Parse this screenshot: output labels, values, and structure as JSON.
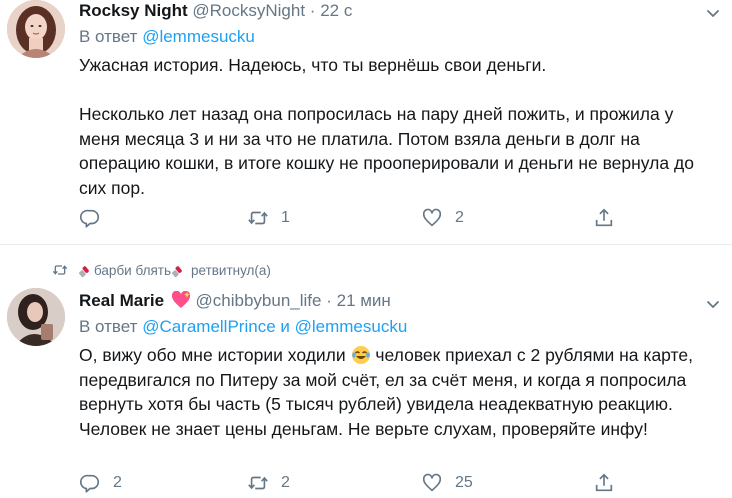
{
  "tweet1": {
    "display_name": "Rocksy Night",
    "handle": "@RocksyNight",
    "separator": "·",
    "time": "22 с",
    "reply_prefix": "В ответ",
    "reply_mention": "@lemmesucku",
    "body": "Ужасная история. Надеюсь, что ты вернёшь свои деньги.\n\nНесколько лет назад она попросилась на пару дней пожить, и прожила у меня месяца 3 и ни за что не платила. Потом взяла деньги в долг на операцию кошки, в итоге кошку не прооперировали и деньги не вернула до сих пор.",
    "retweets": "1",
    "likes": "2"
  },
  "retweet_notice": {
    "name": "барби блять",
    "action": "ретвитнул(а)"
  },
  "tweet2": {
    "display_name": "Real Marie",
    "handle": "@chibbybun_life",
    "separator": "·",
    "time": "21 мин",
    "reply_prefix": "В ответ",
    "reply_mention_1": "@CaramellPrince",
    "reply_and": "и",
    "reply_mention_2": "@lemmesucku",
    "body_part1": "О, вижу обо мне истории ходили",
    "body_part2": " человек приехал с 2 рублями на карте, передвигался по Питеру за мой счёт, ел за счёт меня, и когда я попросила вернуть хотя бы часть (5 тысяч рублей) увидела неадекватную реакцию. Человек не знает цены деньгам. Не верьте слухам, проверяйте инфу!",
    "replies": "2",
    "retweets": "2",
    "likes": "25"
  },
  "colors": {
    "link": "#1da1f2",
    "secondary_text": "#657786",
    "primary_text": "#14171a",
    "divider": "#e6ecf0"
  },
  "icons": [
    "reply-icon",
    "retweet-icon",
    "like-icon",
    "share-icon",
    "chevron-down-icon",
    "lipstick-emoji",
    "heart-emoji",
    "laughing-emoji"
  ]
}
